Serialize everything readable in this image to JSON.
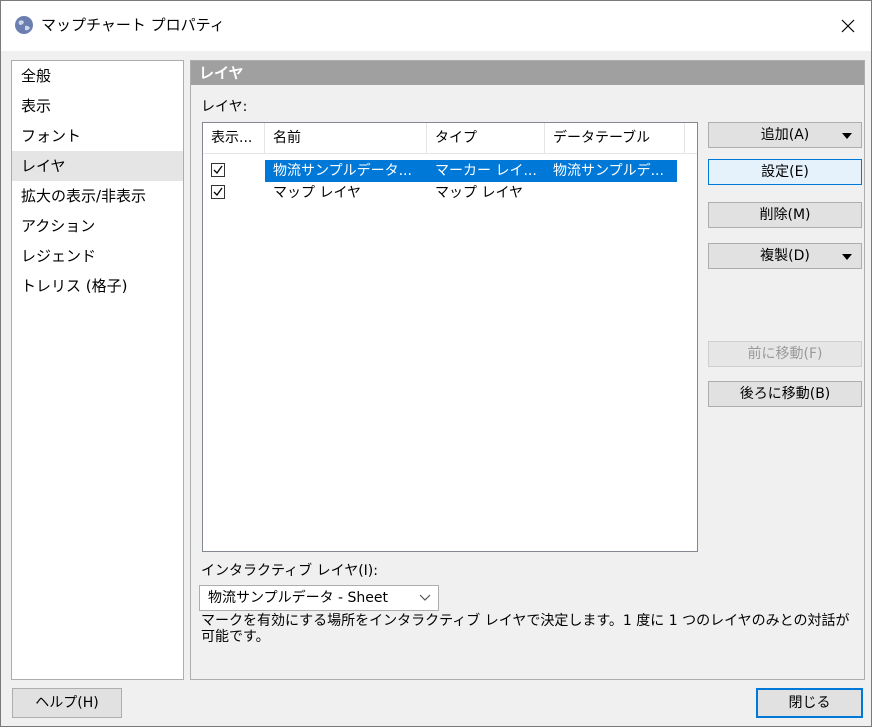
{
  "window": {
    "title": "マップチャート プロパティ"
  },
  "nav": {
    "items": [
      {
        "label": "全般"
      },
      {
        "label": "表示"
      },
      {
        "label": "フォント"
      },
      {
        "label": "レイヤ",
        "selected": true
      },
      {
        "label": "拡大の表示/非表示"
      },
      {
        "label": "アクション"
      },
      {
        "label": "レジェンド"
      },
      {
        "label": "トレリス (格子)"
      }
    ]
  },
  "panel": {
    "header": "レイヤ",
    "layers_label": "レイヤ:",
    "table": {
      "columns": [
        "表示...",
        "名前",
        "タイプ",
        "データテーブル"
      ],
      "rows": [
        {
          "checked": true,
          "name": "物流サンプルデータ...",
          "type": "マーカー レイ...",
          "table": "物流サンプルデ...",
          "selected": true
        },
        {
          "checked": true,
          "name": "マップ レイヤ",
          "type": "マップ レイヤ",
          "table": "",
          "selected": false
        }
      ]
    },
    "buttons": {
      "add": "追加(A)",
      "settings": "設定(E)",
      "delete": "削除(M)",
      "duplicate": "複製(D)",
      "move_up": "前に移動(F)",
      "move_down": "後ろに移動(B)"
    },
    "interactive_label": "インタラクティブ レイヤ(I):",
    "interactive_value": "物流サンプルデータ - Sheet",
    "description": "マークを有効にする場所をインタラクティブ レイヤで決定します。1 度に 1 つのレイヤのみとの対話が可能です。"
  },
  "footer": {
    "help": "ヘルプ(H)",
    "close": "閉じる"
  },
  "colors": {
    "selection": "#0078d7",
    "header": "#a0a0a0"
  }
}
